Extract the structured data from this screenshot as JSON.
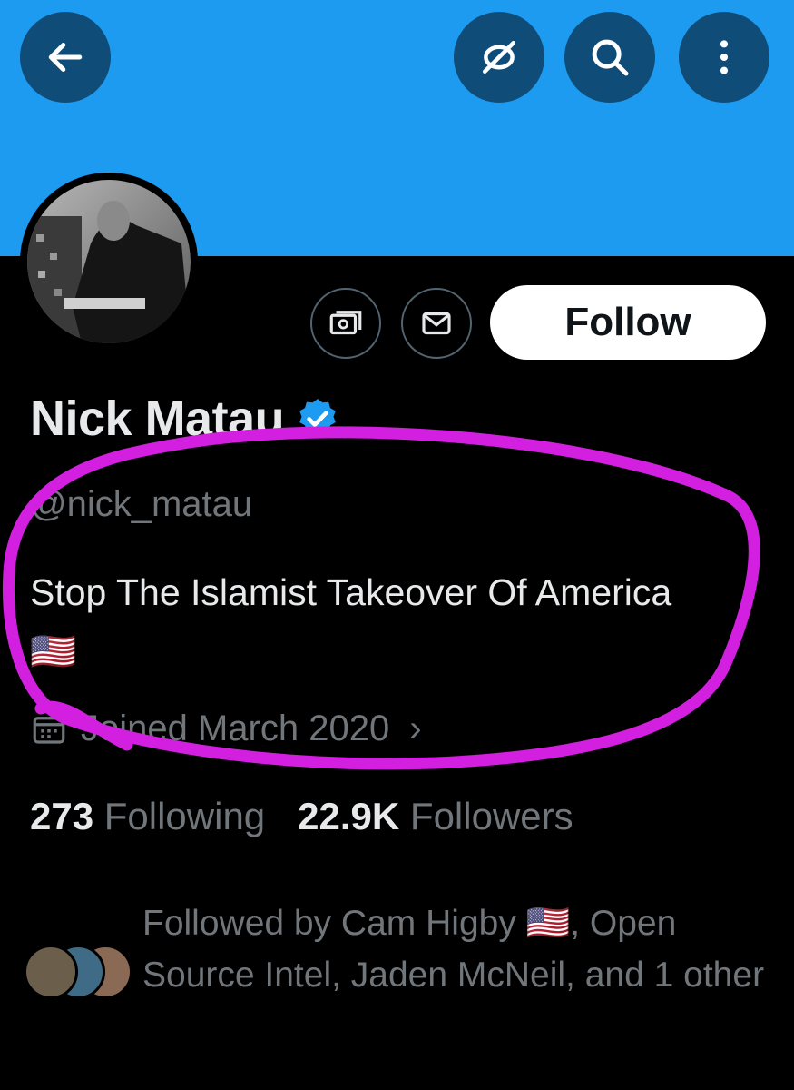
{
  "header": {
    "back_icon": "arrow-left-icon",
    "icons": [
      "hide-eye-icon",
      "search-icon",
      "more-vertical-icon"
    ]
  },
  "profile": {
    "display_name": "Nick Matau",
    "verified_color": "#1d9bf0",
    "handle": "@nick_matau",
    "bio": "Stop The Islamist Takeover Of America 🇺🇸",
    "joined": "Joined March 2020",
    "joined_chevron": "›",
    "follow_label": "Follow",
    "following_count": "273",
    "following_label": "Following",
    "followers_count": "22.9K",
    "followers_label": "Followers",
    "followed_by_text": "Followed by Cam Higby 🇺🇸, Open Source Intel, Jaden McNeil, and 1 other"
  },
  "colors": {
    "banner": "#1d9bf0",
    "highlight_stroke": "#d21fe0"
  }
}
